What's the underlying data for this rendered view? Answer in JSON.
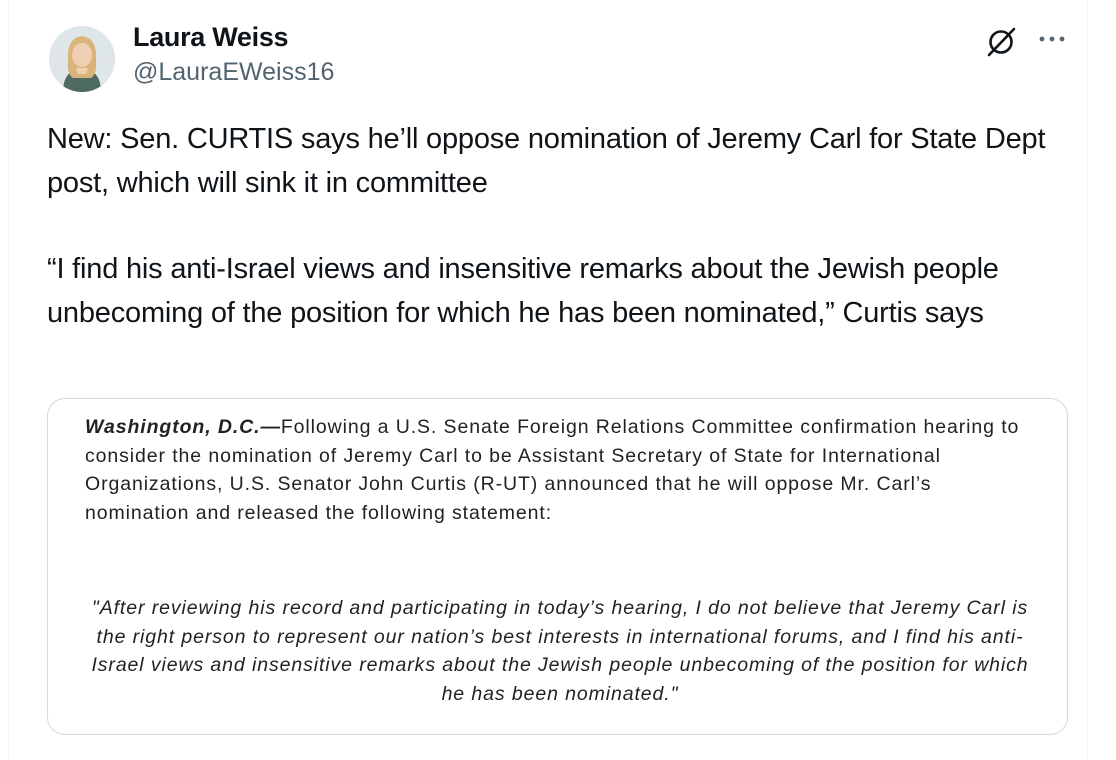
{
  "author": {
    "display_name": "Laura Weiss",
    "handle": "@LauraEWeiss16",
    "avatar_icon": "profile-photo"
  },
  "actions": {
    "grok_icon": "grok-icon",
    "more_icon": "more-options-icon"
  },
  "tweet": {
    "paragraph_1": "New: Sen. CURTIS says he’ll oppose nomination of Jeremy Carl for State Dept post, which will sink it in committee",
    "paragraph_2": "“I find his anti-Israel views and insensitive remarks about the Jewish people unbecoming of the position for which he has been nominated,” Curtis says"
  },
  "media": {
    "dateline": "Washington, D.C.—",
    "body": "Following a U.S. Senate Foreign Relations Committee confirmation hearing to consider the nomination of Jeremy Carl to be Assistant Secretary of State for International Organizations, U.S. Senator John Curtis (R-UT) announced that he will oppose Mr. Carl’s nomination and released the following statement:",
    "quote": "\"After reviewing his record and participating in today’s hearing, I do not believe that Jeremy Carl is the right person to represent our nation’s best interests in international forums, and I find his anti-Israel views and insensitive remarks about the Jewish people unbecoming of the position for which he has been nominated.\""
  },
  "colors": {
    "text_primary": "#0f1419",
    "text_secondary": "#536471",
    "border": "#cfd9de"
  }
}
